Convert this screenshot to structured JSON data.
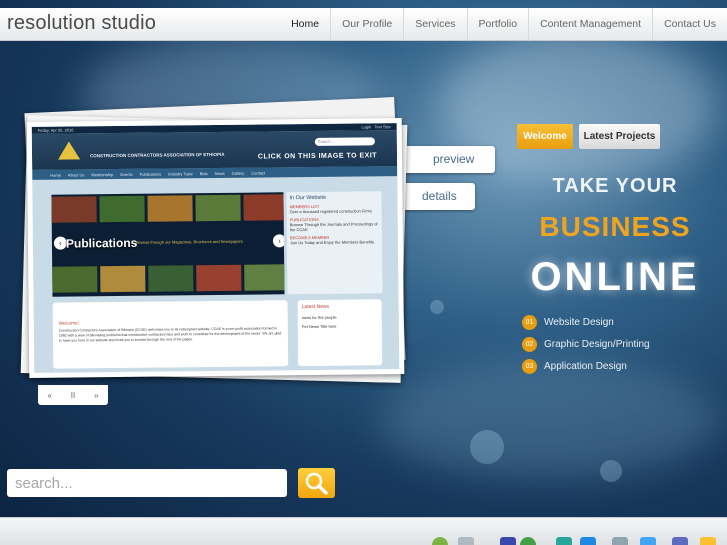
{
  "brand": {
    "name": "resolution studio"
  },
  "nav": [
    {
      "label": "Home",
      "active": true
    },
    {
      "label": "Our Profile"
    },
    {
      "label": "Services"
    },
    {
      "label": "Portfolio"
    },
    {
      "label": "Content Management"
    },
    {
      "label": "Contact Us"
    }
  ],
  "preview": {
    "buttons": {
      "preview": "preview",
      "details": "details"
    },
    "screenshot": {
      "date": "Friday, Apr 25, 2016",
      "login": "Login",
      "text_size": "Text Size",
      "search_placeholder": "Search...",
      "org_name": "CONSTRUCTION CONTRACTORS ASSOCIATION OF ETHIOPIA",
      "exit_hint": "CLICK ON THIS IMAGE TO EXIT",
      "nav": [
        "Home",
        "About Us",
        "Membership",
        "Events",
        "Publications",
        "Industry Topic",
        "Bids",
        "News",
        "Gallery",
        "Contact"
      ],
      "banner_title": "Publications",
      "banner_sub": "Browse through our Magazines, Brochures and Newspapers",
      "side_title": "In Our Website",
      "side_items": [
        {
          "head": "MEMBERS LIST",
          "text": "Over a thousand registered construction Firms"
        },
        {
          "head": "PUBLICATIONS",
          "text": "Browse Through the Journals and Proceedings of the CCAE"
        },
        {
          "head": "BECOME A MEMBER",
          "text": "Join Us Today and Enjoy the Members Benefits"
        }
      ],
      "welcome_title": "Welcome!",
      "welcome_text": "Construction Contractors Association of Ethiopia (CCAE) welcomes you to its redesigned website. CCAE is a non profit association formed in 1992 with a view of alleviating problems that construction contractors face and work to contribute for the development of the sector. We are glad to have you here in our website and invite you to browse through the rest of the pages.",
      "latest_title": "Latest News",
      "latest_items": [
        "news for the people",
        "Pet News Title here"
      ]
    },
    "controls": {
      "prev": "«",
      "pause": "II",
      "next": "»"
    }
  },
  "promo": {
    "tabs": {
      "welcome": "Welcome",
      "latest": "Latest Projects"
    },
    "line1": "TAKE YOUR",
    "line2": "BUSINESS",
    "line3": "ONLINE",
    "services": [
      {
        "num": "01",
        "label": "Website Design"
      },
      {
        "num": "02",
        "label": "Graphic Design/Printing"
      },
      {
        "num": "03",
        "label": "Application Design"
      }
    ]
  },
  "search": {
    "placeholder": "search..."
  },
  "colors": {
    "accent": "#f0a41d",
    "link": "#4a6a8a"
  },
  "footer_icons": [
    "recycle-icon",
    "gear-icon",
    "grid-icon",
    "leaf-icon",
    "dots-icon",
    "puzzle-icon",
    "box-icon",
    "chart-icon",
    "clock-icon",
    "hand-icon",
    "arrow-icon"
  ]
}
